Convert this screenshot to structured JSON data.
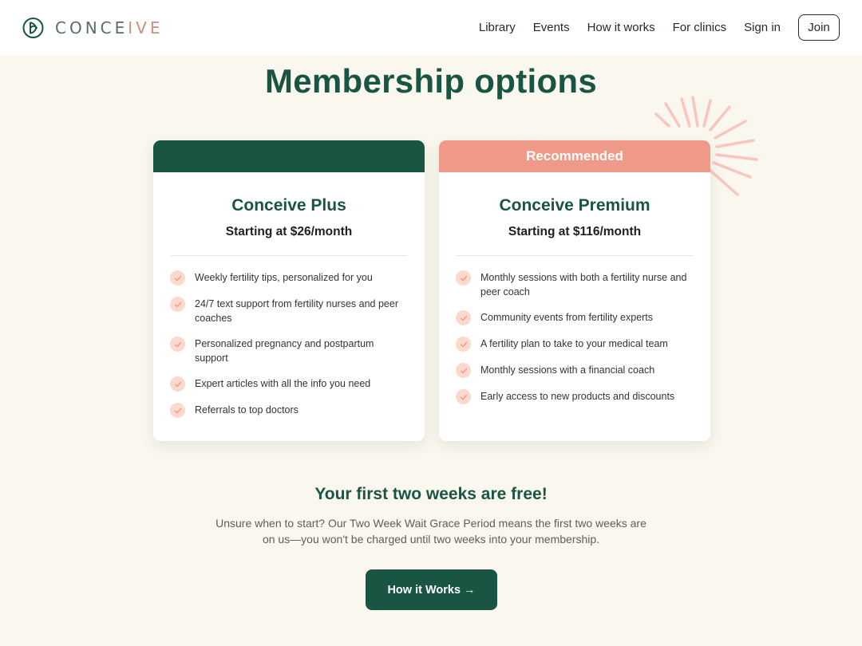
{
  "header": {
    "logo_text": "CONCEIVE",
    "nav": [
      "Library",
      "Events",
      "How it works",
      "For clinics",
      "Sign in"
    ],
    "join_label": "Join"
  },
  "page_title": "Membership options",
  "plans": [
    {
      "band_label": "",
      "name": "Conceive Plus",
      "price": "Starting at $26/month",
      "features": [
        "Weekly fertility tips, personalized for you",
        "24/7 text support from fertility nurses and peer coaches",
        "Personalized pregnancy and postpartum support",
        "Expert articles with all the info you need",
        "Referrals to top doctors"
      ]
    },
    {
      "band_label": "Recommended",
      "name": "Conceive Premium",
      "price": "Starting at $116/month",
      "features": [
        "Monthly sessions with both a fertility nurse and peer coach",
        "Community events from fertility experts",
        "A fertility plan to take to your medical team",
        "Monthly sessions with a financial coach",
        "Early access to new products and discounts"
      ]
    }
  ],
  "free_trial": {
    "title": "Your first two weeks are free!",
    "description": "Unsure when to start? Our Two Week Wait Grace Period means the first two weeks are on us—you won't be charged until two weeks into your membership.",
    "cta_label": "How it Works →"
  },
  "colors": {
    "brand_green": "#1a5443",
    "accent_coral": "#ef9a88",
    "check_bg": "#fbd9cd",
    "page_bg": "#faf7ef"
  },
  "icons": [
    "conceive-logo-icon",
    "check-icon",
    "sunburst-decoration-icon"
  ]
}
